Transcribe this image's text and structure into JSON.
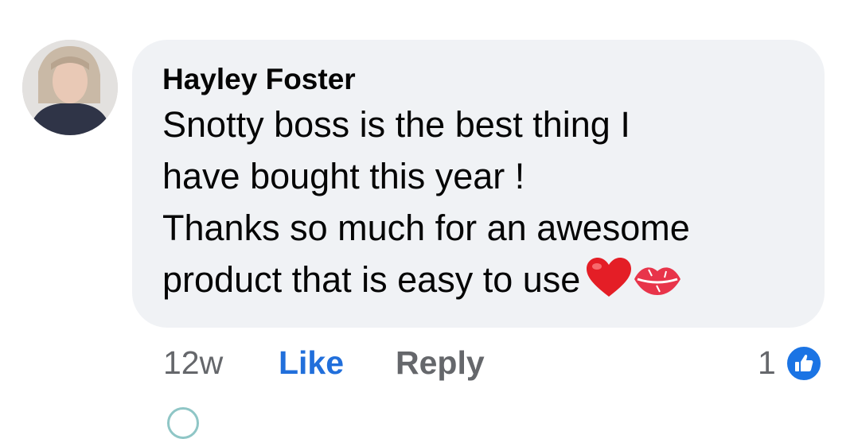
{
  "comment": {
    "author": "Hayley Foster",
    "text_lines": [
      "Snotty boss is the best thing I",
      "have bought this year !",
      "Thanks so much for an awesome",
      "product that is easy to use"
    ],
    "emojis": [
      "red-heart-emoji",
      "kiss-mark-emoji"
    ],
    "time": "12w",
    "like_label": "Like",
    "reply_label": "Reply",
    "reaction_count": "1",
    "reaction_icon": "like-reaction-icon"
  },
  "colors": {
    "bubble": "#f0f2f5",
    "like_blue": "#216fdb",
    "meta_gray": "#65676b",
    "reaction_badge": "#1b74e4"
  }
}
